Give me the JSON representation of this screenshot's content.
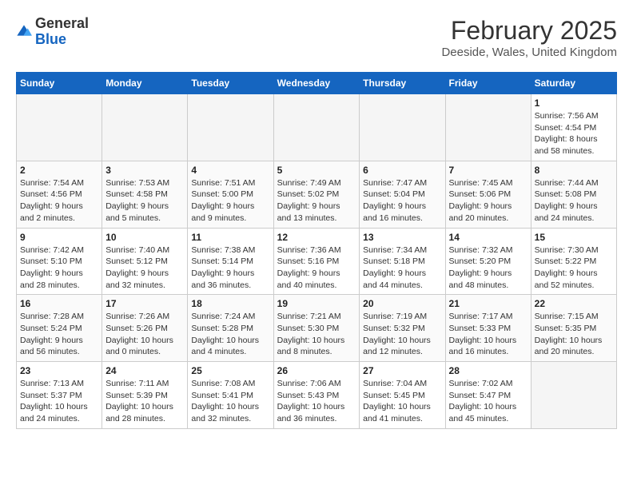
{
  "header": {
    "logo_general": "General",
    "logo_blue": "Blue",
    "title": "February 2025",
    "subtitle": "Deeside, Wales, United Kingdom"
  },
  "days_of_week": [
    "Sunday",
    "Monday",
    "Tuesday",
    "Wednesday",
    "Thursday",
    "Friday",
    "Saturday"
  ],
  "weeks": [
    [
      {
        "num": "",
        "detail": "",
        "empty": true
      },
      {
        "num": "",
        "detail": "",
        "empty": true
      },
      {
        "num": "",
        "detail": "",
        "empty": true
      },
      {
        "num": "",
        "detail": "",
        "empty": true
      },
      {
        "num": "",
        "detail": "",
        "empty": true
      },
      {
        "num": "",
        "detail": "",
        "empty": true
      },
      {
        "num": "1",
        "detail": "Sunrise: 7:56 AM\nSunset: 4:54 PM\nDaylight: 8 hours and 58 minutes.",
        "empty": false
      }
    ],
    [
      {
        "num": "2",
        "detail": "Sunrise: 7:54 AM\nSunset: 4:56 PM\nDaylight: 9 hours and 2 minutes.",
        "empty": false
      },
      {
        "num": "3",
        "detail": "Sunrise: 7:53 AM\nSunset: 4:58 PM\nDaylight: 9 hours and 5 minutes.",
        "empty": false
      },
      {
        "num": "4",
        "detail": "Sunrise: 7:51 AM\nSunset: 5:00 PM\nDaylight: 9 hours and 9 minutes.",
        "empty": false
      },
      {
        "num": "5",
        "detail": "Sunrise: 7:49 AM\nSunset: 5:02 PM\nDaylight: 9 hours and 13 minutes.",
        "empty": false
      },
      {
        "num": "6",
        "detail": "Sunrise: 7:47 AM\nSunset: 5:04 PM\nDaylight: 9 hours and 16 minutes.",
        "empty": false
      },
      {
        "num": "7",
        "detail": "Sunrise: 7:45 AM\nSunset: 5:06 PM\nDaylight: 9 hours and 20 minutes.",
        "empty": false
      },
      {
        "num": "8",
        "detail": "Sunrise: 7:44 AM\nSunset: 5:08 PM\nDaylight: 9 hours and 24 minutes.",
        "empty": false
      }
    ],
    [
      {
        "num": "9",
        "detail": "Sunrise: 7:42 AM\nSunset: 5:10 PM\nDaylight: 9 hours and 28 minutes.",
        "empty": false
      },
      {
        "num": "10",
        "detail": "Sunrise: 7:40 AM\nSunset: 5:12 PM\nDaylight: 9 hours and 32 minutes.",
        "empty": false
      },
      {
        "num": "11",
        "detail": "Sunrise: 7:38 AM\nSunset: 5:14 PM\nDaylight: 9 hours and 36 minutes.",
        "empty": false
      },
      {
        "num": "12",
        "detail": "Sunrise: 7:36 AM\nSunset: 5:16 PM\nDaylight: 9 hours and 40 minutes.",
        "empty": false
      },
      {
        "num": "13",
        "detail": "Sunrise: 7:34 AM\nSunset: 5:18 PM\nDaylight: 9 hours and 44 minutes.",
        "empty": false
      },
      {
        "num": "14",
        "detail": "Sunrise: 7:32 AM\nSunset: 5:20 PM\nDaylight: 9 hours and 48 minutes.",
        "empty": false
      },
      {
        "num": "15",
        "detail": "Sunrise: 7:30 AM\nSunset: 5:22 PM\nDaylight: 9 hours and 52 minutes.",
        "empty": false
      }
    ],
    [
      {
        "num": "16",
        "detail": "Sunrise: 7:28 AM\nSunset: 5:24 PM\nDaylight: 9 hours and 56 minutes.",
        "empty": false
      },
      {
        "num": "17",
        "detail": "Sunrise: 7:26 AM\nSunset: 5:26 PM\nDaylight: 10 hours and 0 minutes.",
        "empty": false
      },
      {
        "num": "18",
        "detail": "Sunrise: 7:24 AM\nSunset: 5:28 PM\nDaylight: 10 hours and 4 minutes.",
        "empty": false
      },
      {
        "num": "19",
        "detail": "Sunrise: 7:21 AM\nSunset: 5:30 PM\nDaylight: 10 hours and 8 minutes.",
        "empty": false
      },
      {
        "num": "20",
        "detail": "Sunrise: 7:19 AM\nSunset: 5:32 PM\nDaylight: 10 hours and 12 minutes.",
        "empty": false
      },
      {
        "num": "21",
        "detail": "Sunrise: 7:17 AM\nSunset: 5:33 PM\nDaylight: 10 hours and 16 minutes.",
        "empty": false
      },
      {
        "num": "22",
        "detail": "Sunrise: 7:15 AM\nSunset: 5:35 PM\nDaylight: 10 hours and 20 minutes.",
        "empty": false
      }
    ],
    [
      {
        "num": "23",
        "detail": "Sunrise: 7:13 AM\nSunset: 5:37 PM\nDaylight: 10 hours and 24 minutes.",
        "empty": false
      },
      {
        "num": "24",
        "detail": "Sunrise: 7:11 AM\nSunset: 5:39 PM\nDaylight: 10 hours and 28 minutes.",
        "empty": false
      },
      {
        "num": "25",
        "detail": "Sunrise: 7:08 AM\nSunset: 5:41 PM\nDaylight: 10 hours and 32 minutes.",
        "empty": false
      },
      {
        "num": "26",
        "detail": "Sunrise: 7:06 AM\nSunset: 5:43 PM\nDaylight: 10 hours and 36 minutes.",
        "empty": false
      },
      {
        "num": "27",
        "detail": "Sunrise: 7:04 AM\nSunset: 5:45 PM\nDaylight: 10 hours and 41 minutes.",
        "empty": false
      },
      {
        "num": "28",
        "detail": "Sunrise: 7:02 AM\nSunset: 5:47 PM\nDaylight: 10 hours and 45 minutes.",
        "empty": false
      },
      {
        "num": "",
        "detail": "",
        "empty": true
      }
    ]
  ]
}
